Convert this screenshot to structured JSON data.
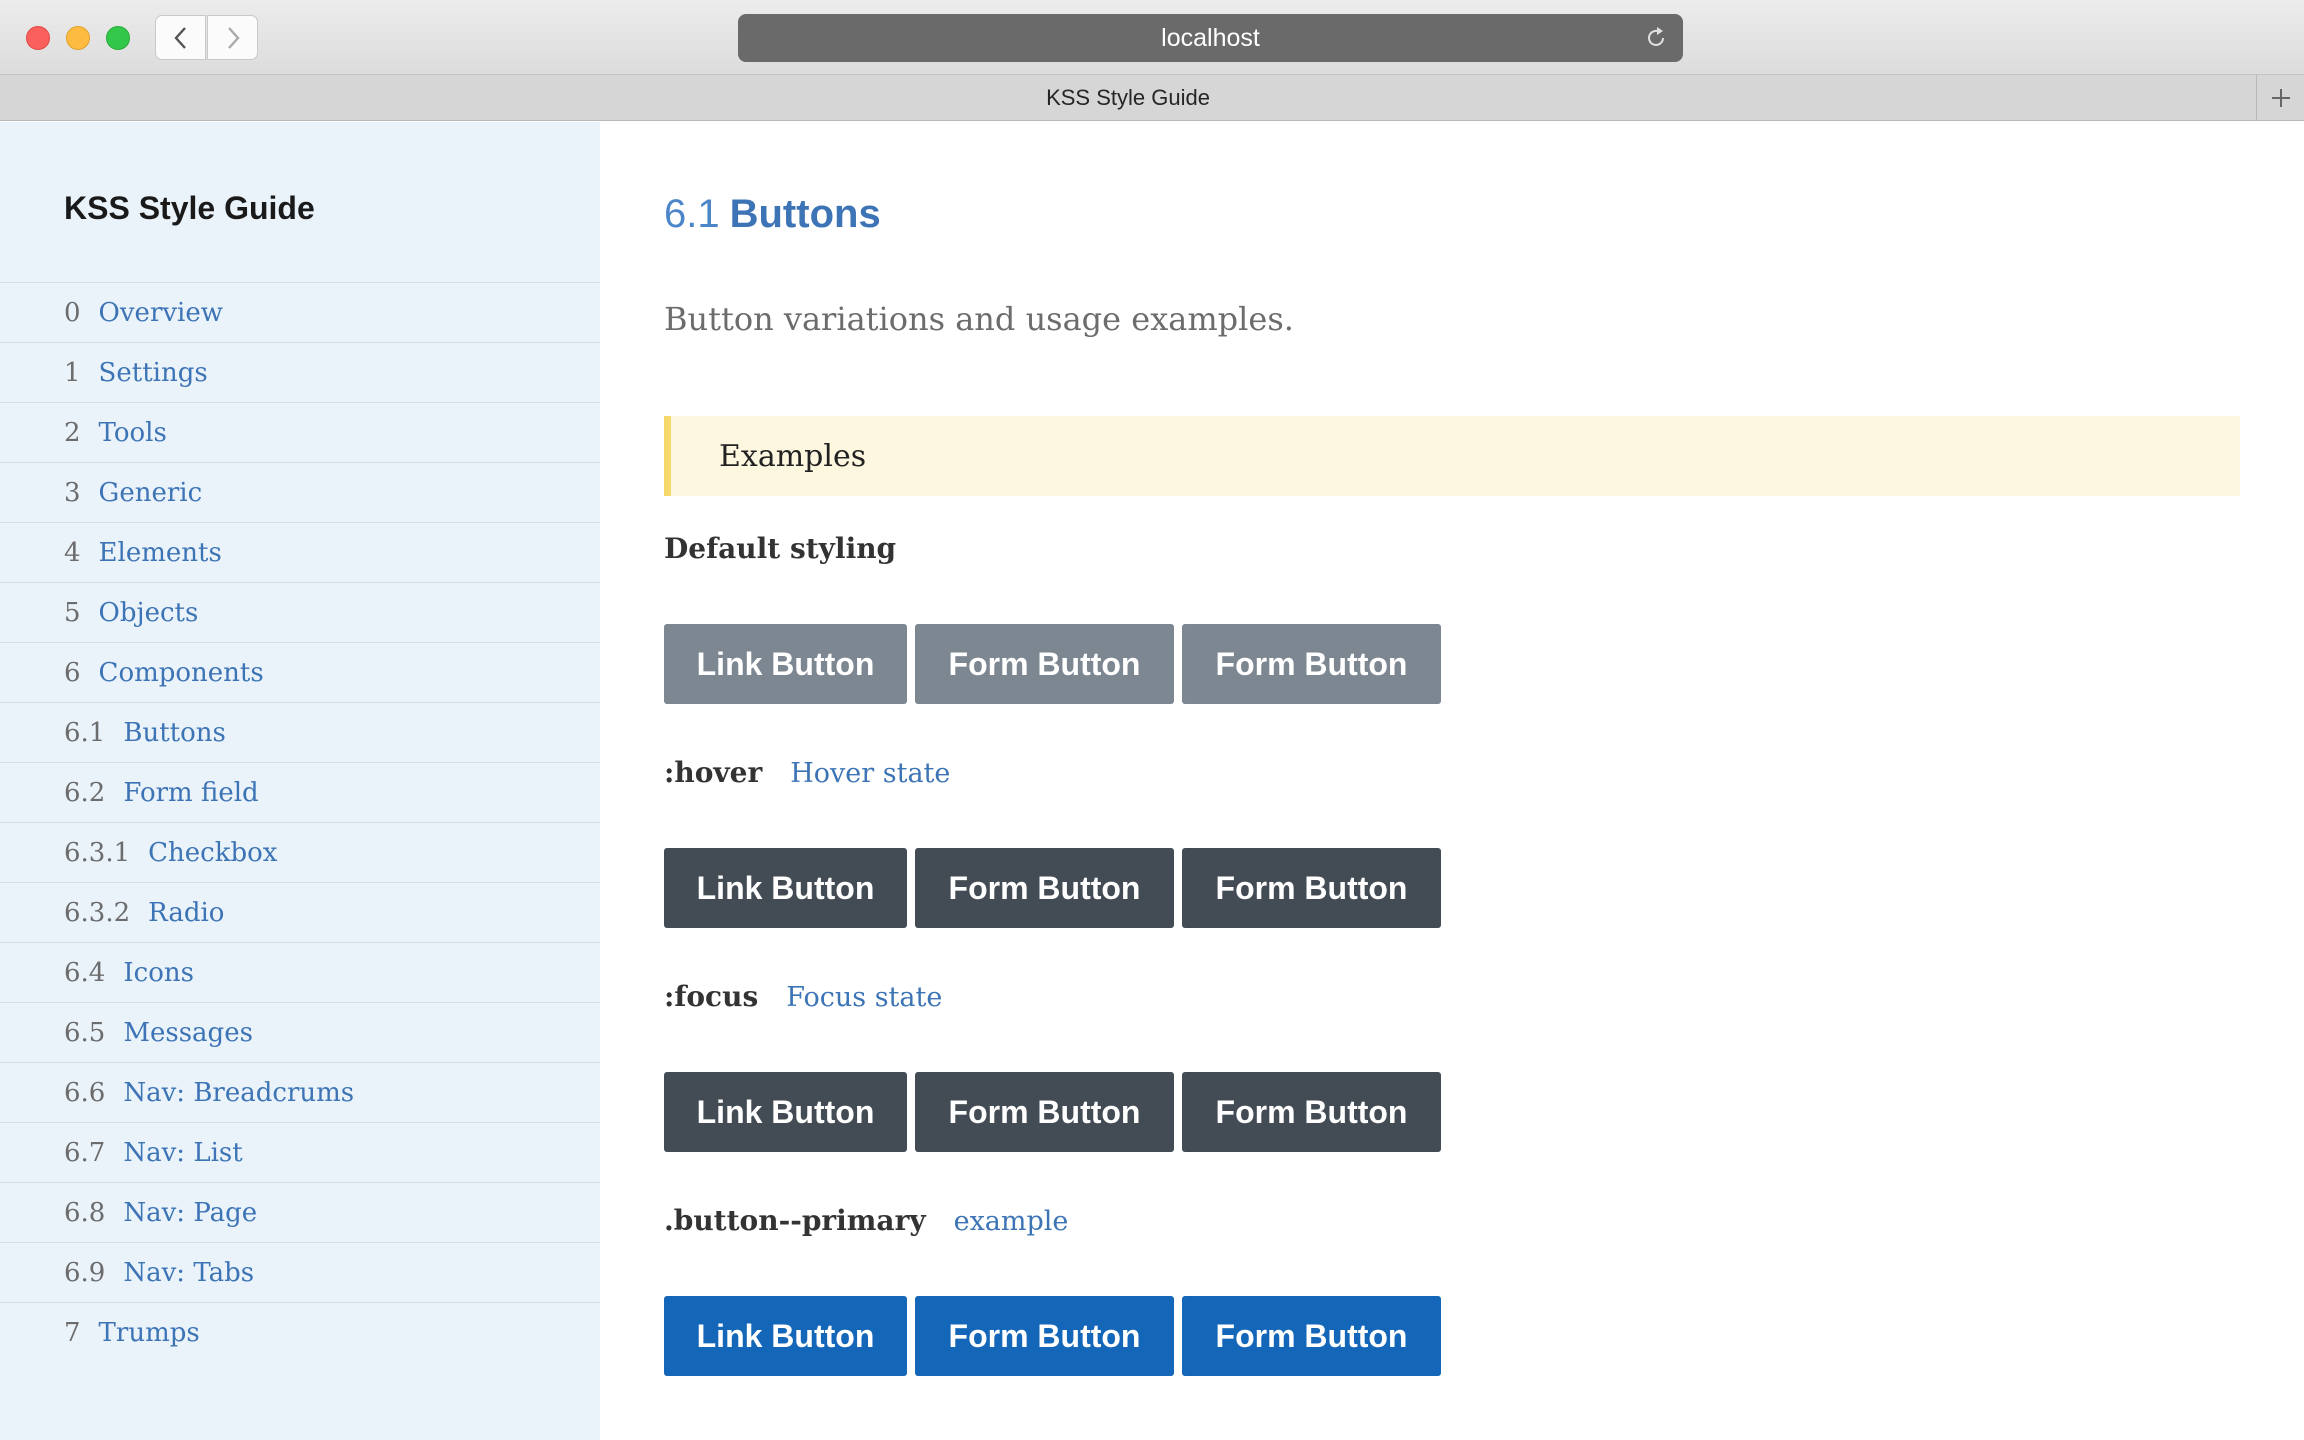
{
  "browser": {
    "url": "localhost",
    "tab_title": "KSS Style Guide"
  },
  "sidebar": {
    "site_title": "KSS Style Guide",
    "items": [
      {
        "num": "0",
        "label": "Overview"
      },
      {
        "num": "1",
        "label": "Settings"
      },
      {
        "num": "2",
        "label": "Tools"
      },
      {
        "num": "3",
        "label": "Generic"
      },
      {
        "num": "4",
        "label": "Elements"
      },
      {
        "num": "5",
        "label": "Objects"
      },
      {
        "num": "6",
        "label": "Components"
      },
      {
        "num": "6.1",
        "label": "Buttons"
      },
      {
        "num": "6.2",
        "label": "Form field"
      },
      {
        "num": "6.3.1",
        "label": "Checkbox"
      },
      {
        "num": "6.3.2",
        "label": "Radio"
      },
      {
        "num": "6.4",
        "label": "Icons"
      },
      {
        "num": "6.5",
        "label": "Messages"
      },
      {
        "num": "6.6",
        "label": "Nav: Breadcrums"
      },
      {
        "num": "6.7",
        "label": "Nav: List"
      },
      {
        "num": "6.8",
        "label": "Nav: Page"
      },
      {
        "num": "6.9",
        "label": "Nav: Tabs"
      },
      {
        "num": "7",
        "label": "Trumps"
      }
    ]
  },
  "main": {
    "section_num": "6.1",
    "section_title": "Buttons",
    "description": "Button variations and usage examples.",
    "examples_label": "Examples",
    "default_heading": "Default styling",
    "buttons": [
      "Link Button",
      "Form Button",
      "Form Button"
    ],
    "modifiers": [
      {
        "name": ":hover",
        "desc": "Hover state"
      },
      {
        "name": ":focus",
        "desc": "Focus state"
      },
      {
        "name": ".button--primary",
        "desc": "example"
      }
    ]
  },
  "colors": {
    "accent": "#3c74b5",
    "button_default": "#7d8791",
    "button_dark": "#434c54",
    "button_primary": "#1466b8",
    "examples_bg": "#fdf7e0",
    "sidebar_bg": "#eaf2fa"
  }
}
